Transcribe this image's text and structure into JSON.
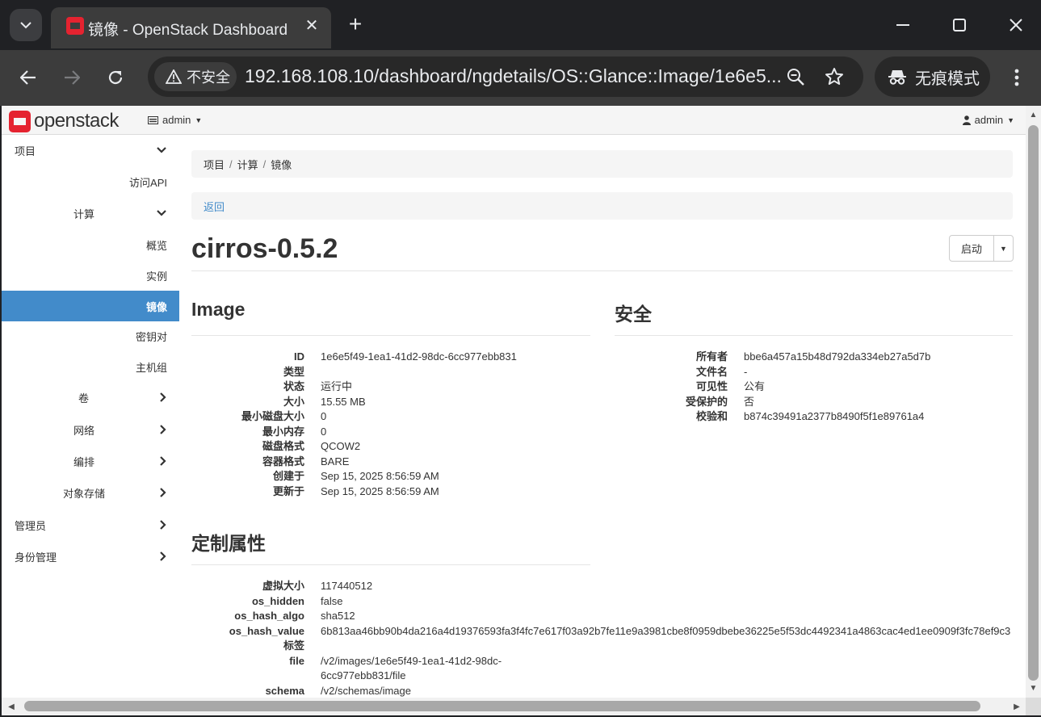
{
  "browser": {
    "tab_title": "镜像 - OpenStack Dashboard",
    "tab_close_glyph": "✕",
    "new_tab_glyph": "+",
    "security_label": "不安全",
    "url": "192.168.108.10/dashboard/ngdetails/OS::Glance::Image/1e6e5...",
    "incognito_label": "无痕模式"
  },
  "navbar": {
    "logo_text": "openstack",
    "project_label": "admin",
    "user_label": "admin"
  },
  "sidebar": {
    "project": "项目",
    "api_access": "访问API",
    "compute": "计算",
    "overview": "概览",
    "instances": "实例",
    "images": "镜像",
    "key_pairs": "密钥对",
    "server_groups": "主机组",
    "volumes": "卷",
    "network": "网络",
    "orchestration": "编排",
    "object_store": "对象存储",
    "admin": "管理员",
    "identity": "身份管理"
  },
  "breadcrumb": [
    "项目",
    "计算",
    "镜像"
  ],
  "back_label": "返回",
  "page_title": "cirros-0.5.2",
  "launch_label": "启动",
  "image_section": {
    "title": "Image",
    "rows": [
      {
        "label": "ID",
        "value": "1e6e5f49-1ea1-41d2-98dc-6cc977ebb831"
      },
      {
        "label": "类型",
        "value": ""
      },
      {
        "label": "状态",
        "value": "运行中"
      },
      {
        "label": "大小",
        "value": "15.55 MB"
      },
      {
        "label": "最小磁盘大小",
        "value": "0"
      },
      {
        "label": "最小内存",
        "value": "0"
      },
      {
        "label": "磁盘格式",
        "value": "QCOW2"
      },
      {
        "label": "容器格式",
        "value": "BARE"
      },
      {
        "label": "创建于",
        "value": "Sep 15, 2025 8:56:59 AM"
      },
      {
        "label": "更新于",
        "value": "Sep 15, 2025 8:56:59 AM"
      }
    ]
  },
  "security_section": {
    "title": "安全",
    "rows": [
      {
        "label": "所有者",
        "value": "bbe6a457a15b48d792da334eb27a5d7b"
      },
      {
        "label": "文件名",
        "value": "-"
      },
      {
        "label": "可见性",
        "value": "公有"
      },
      {
        "label": "受保护的",
        "value": "否"
      },
      {
        "label": "校验和",
        "value": "b874c39491a2377b8490f5f1e89761a4"
      }
    ]
  },
  "custom_section": {
    "title": "定制属性",
    "rows": [
      {
        "label": "虚拟大小",
        "value": "117440512"
      },
      {
        "label": "os_hidden",
        "value": "false"
      },
      {
        "label": "os_hash_algo",
        "value": "sha512"
      },
      {
        "label": "os_hash_value",
        "value": "6b813aa46bb90b4da216a4d19376593fa3f4fc7e617f03a92b7fe11e9a3981cbe8f0959dbebe36225e5f53dc4492341a4863cac4ed1ee0909f3fc78ef9c3"
      },
      {
        "label": "标签",
        "value": ""
      },
      {
        "label": "file",
        "value": "/v2/images/1e6e5f49-1ea1-41d2-98dc-6cc977ebb831/file"
      },
      {
        "label": "schema",
        "value": "/v2/schemas/image"
      }
    ]
  },
  "colors": {
    "accent": "#428bca",
    "brand_red": "#e52330",
    "chrome_dark": "#202124",
    "chrome_toolbar": "#3c3c3c"
  }
}
